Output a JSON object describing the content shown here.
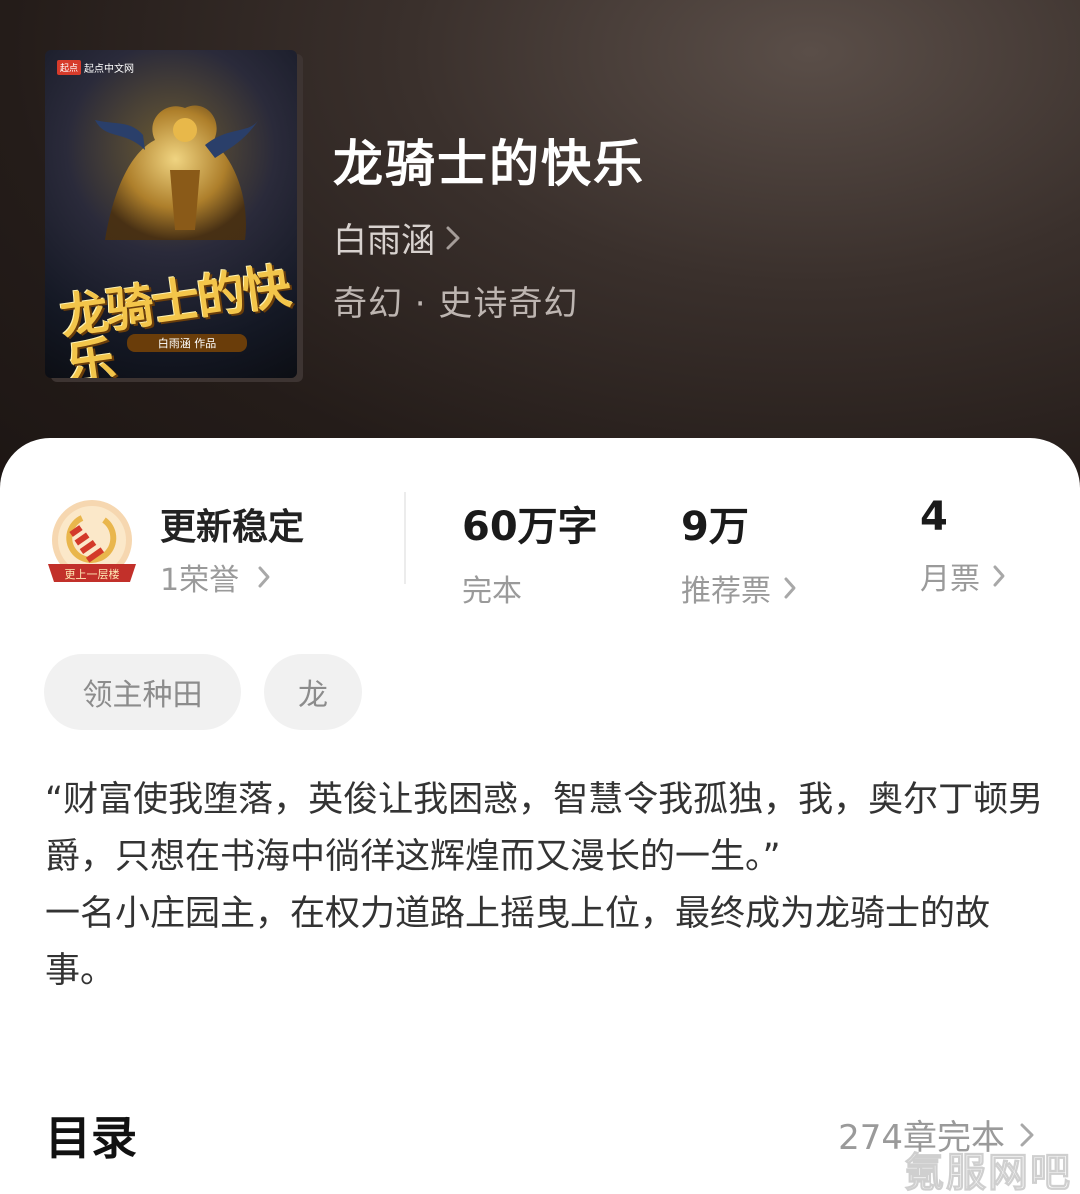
{
  "book": {
    "title": "龙骑士的快乐",
    "author": "白雨涵",
    "genre": "奇幻 · 史诗奇幻",
    "cover": {
      "publisher": "起点中文网",
      "publisher_badge": "起点",
      "title": "龙骑士的快乐",
      "author_credit": "白雨涵 作品"
    }
  },
  "honor": {
    "title": "更新稳定",
    "count_label": "1荣誉",
    "badge_text": "更上一层楼"
  },
  "stats": [
    {
      "value": "60万字",
      "label": "完本"
    },
    {
      "value": "9万",
      "label": "推荐票"
    },
    {
      "value": "4",
      "label": "月票"
    }
  ],
  "tags": [
    "领主种田",
    "龙"
  ],
  "synopsis": "“财富使我堕落，英俊让我困惑，智慧令我孤独，我，奥尔丁顿男爵，只想在书海中徜徉这辉煌而又漫长的一生。”\n一名小庄园主，在权力道路上摇曳上位，最终成为龙骑士的故事。",
  "toc": {
    "title": "目录",
    "meta": "274章完本"
  },
  "watermark": "氪服网吧",
  "colors": {
    "hero_bg": "#241c19",
    "title_gold": "#f3c54a",
    "text_primary": "#222222",
    "text_secondary": "#9a9a9a",
    "tag_bg": "#f1f1f1"
  }
}
